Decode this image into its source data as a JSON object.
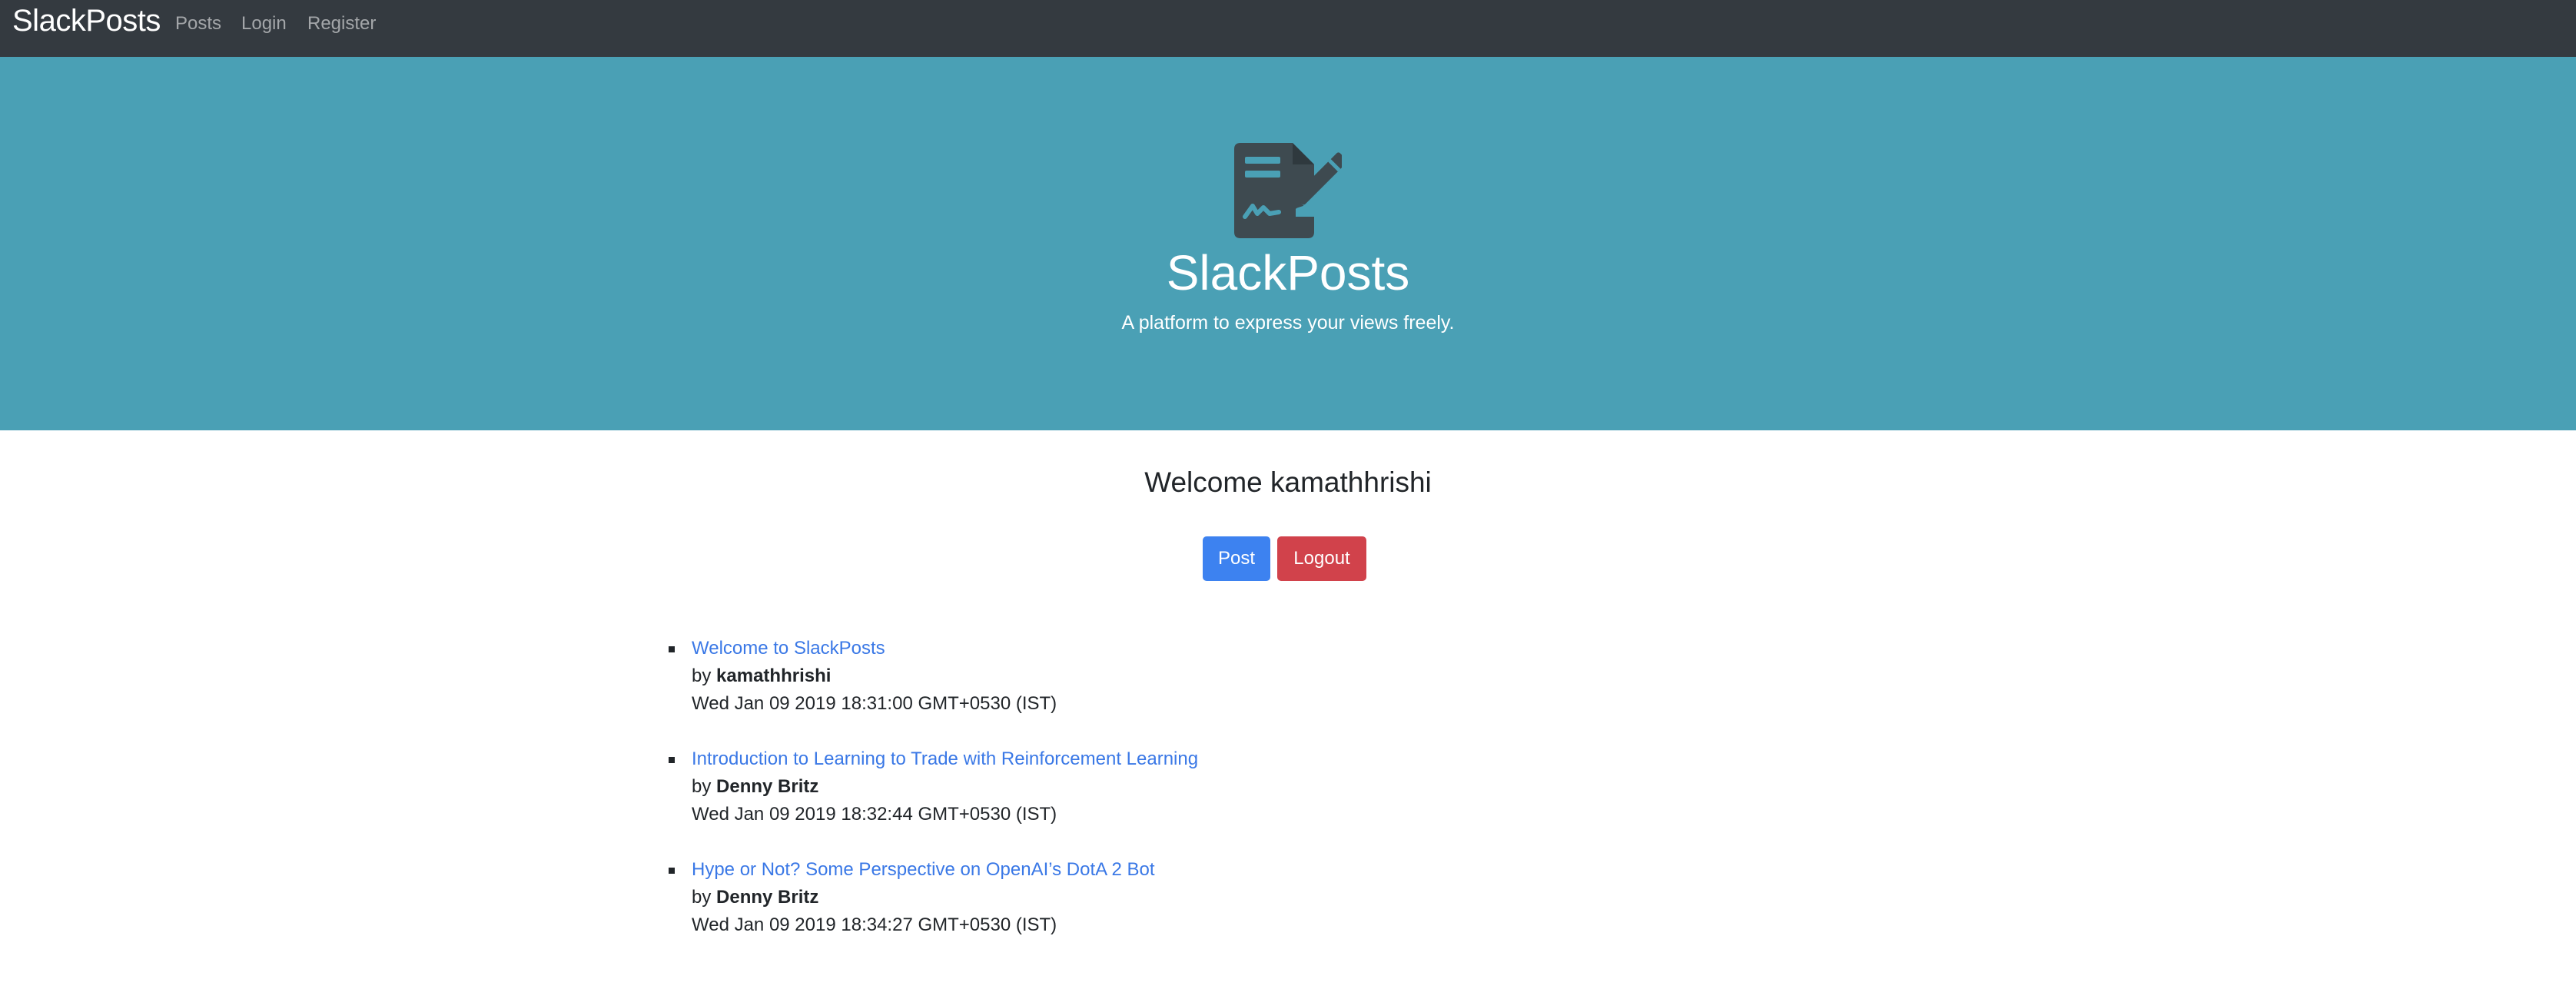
{
  "navbar": {
    "brand": "SlackPosts",
    "links": [
      {
        "label": "Posts"
      },
      {
        "label": "Login"
      },
      {
        "label": "Register"
      }
    ]
  },
  "hero": {
    "icon": "file-signature-icon",
    "title": "SlackPosts",
    "subtitle": "A platform to express your views freely.",
    "background_color": "#4aa0b5"
  },
  "welcome": {
    "text": "Welcome kamathhrishi",
    "post_button": "Post",
    "logout_button": "Logout"
  },
  "posts": [
    {
      "title": "Welcome to SlackPosts",
      "by_prefix": "by",
      "author": "kamathhrishi",
      "date": "Wed Jan 09 2019 18:31:00 GMT+0530 (IST)"
    },
    {
      "title": "Introduction to Learning to Trade with Reinforcement Learning",
      "by_prefix": "by",
      "author": "Denny Britz",
      "date": "Wed Jan 09 2019 18:32:44 GMT+0530 (IST)"
    },
    {
      "title": "Hype or Not? Some Perspective on OpenAI’s DotA 2 Bot",
      "by_prefix": "by",
      "author": "Denny Britz",
      "date": "Wed Jan 09 2019 18:34:27 GMT+0530 (IST)"
    }
  ],
  "colors": {
    "navbar": "#343a40",
    "link": "#3a78e6",
    "primary_button": "#3d82f0",
    "danger_button": "#d1424b"
  }
}
